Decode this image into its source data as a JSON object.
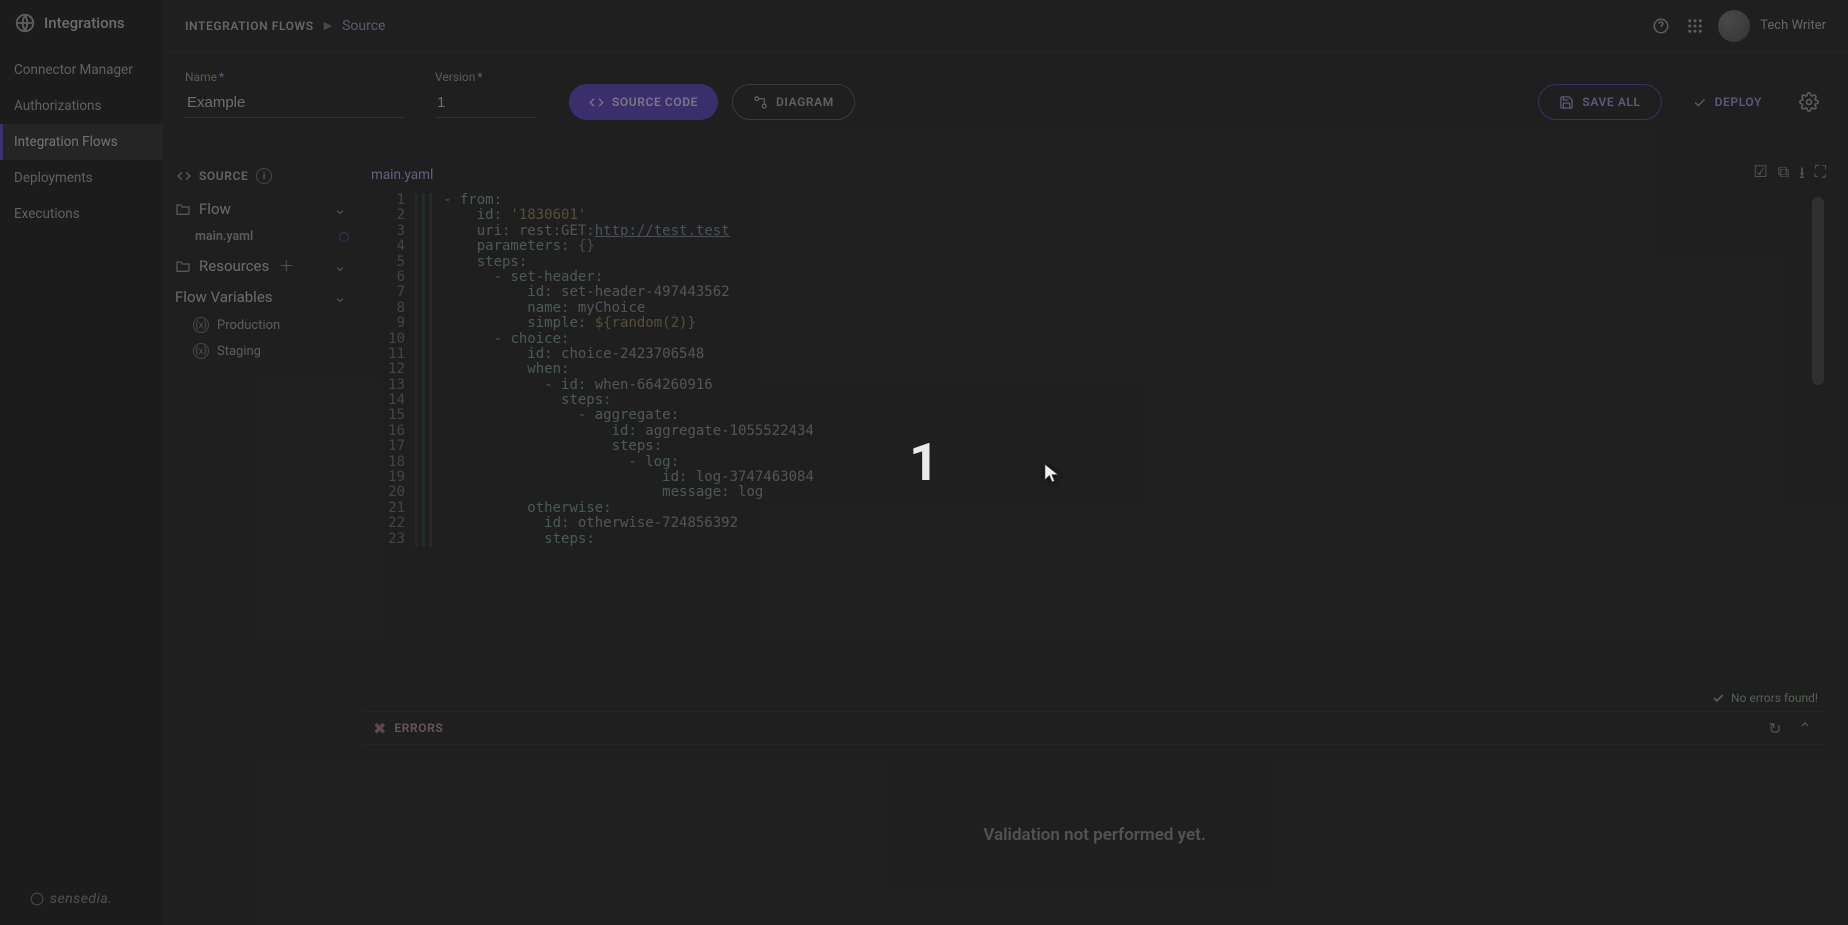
{
  "brand": "Integrations",
  "nav": {
    "items": [
      {
        "label": "Connector Manager"
      },
      {
        "label": "Authorizations"
      },
      {
        "label": "Integration Flows"
      },
      {
        "label": "Deployments"
      },
      {
        "label": "Executions"
      }
    ],
    "activeIndex": 2
  },
  "footer_brand": "sensedia",
  "topbar": {
    "crumb1": "INTEGRATION FLOWS",
    "crumb2": "Source",
    "user": "Tech Writer"
  },
  "form": {
    "name_label": "Name",
    "name_value": "Example",
    "version_label": "Version",
    "version_value": "1",
    "source_code_btn": "SOURCE CODE",
    "diagram_btn": "DIAGRAM",
    "save_all_btn": "SAVE ALL",
    "deploy_btn": "DEPLOY"
  },
  "tree": {
    "header": "SOURCE",
    "flow_label": "Flow",
    "main_file": "main.yaml",
    "resources_label": "Resources",
    "variables_label": "Flow Variables",
    "envs": [
      {
        "name": "Production"
      },
      {
        "name": "Staging"
      }
    ]
  },
  "editor": {
    "filename": "main.yaml",
    "no_errors": "No errors found!",
    "lines": [
      "- from:",
      "    id: '1830601'",
      "    uri: rest:GET:http://test.test",
      "    parameters: {}",
      "    steps:",
      "      - set-header:",
      "          id: set-header-497443562",
      "          name: myChoice",
      "          simple: ${random(2)}",
      "      - choice:",
      "          id: choice-2423706548",
      "          when:",
      "            - id: when-664260916",
      "              steps:",
      "                - aggregate:",
      "                    id: aggregate-1055522434",
      "                    steps:",
      "                      - log:",
      "                          id: log-3747463084",
      "                          message: log",
      "          otherwise:",
      "            id: otherwise-724856392",
      "            steps:"
    ]
  },
  "errors": {
    "tab": "ERRORS",
    "body": "Validation not performed yet."
  },
  "overlay": {
    "center_text": "1"
  }
}
